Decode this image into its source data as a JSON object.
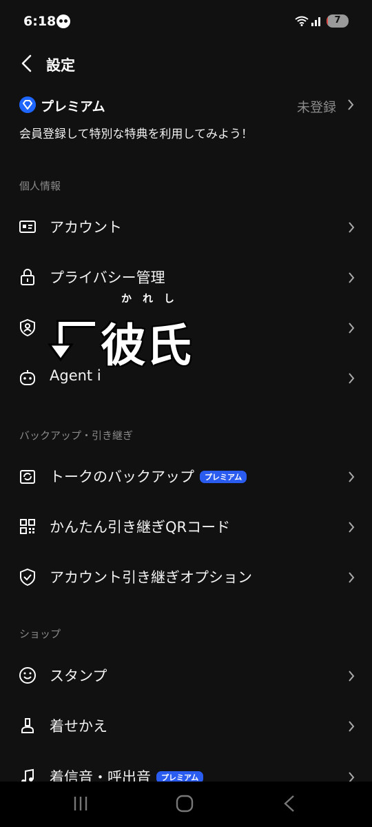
{
  "status_bar": {
    "time": "6:18",
    "battery_level": "7",
    "battery_fraction": 0.07
  },
  "header": {
    "title": "設定"
  },
  "premium": {
    "brand": "プレミアム",
    "status": "未登録",
    "description": "会員登録して特別な特典を利用してみよう！"
  },
  "sections": {
    "personal": {
      "title": "個人情報",
      "items": [
        {
          "label": "アカウント",
          "icon": "id-card-icon"
        },
        {
          "label": "プライバシー管理",
          "icon": "lock-icon"
        },
        {
          "label": "",
          "icon": "shield-user-icon"
        },
        {
          "label": "Agent i",
          "icon": "robot-icon"
        }
      ]
    },
    "backup": {
      "title": "バックアップ・引き継ぎ",
      "items": [
        {
          "label": "トークのバックアップ",
          "icon": "backup-icon",
          "badge": "プレミアム"
        },
        {
          "label": "かんたん引き継ぎQRコード",
          "icon": "qr-code-icon"
        },
        {
          "label": "アカウント引き継ぎオプション",
          "icon": "shield-check-icon"
        }
      ]
    },
    "shop": {
      "title": "ショップ",
      "items": [
        {
          "label": "スタンプ",
          "icon": "smiley-icon"
        },
        {
          "label": "着せかえ",
          "icon": "brush-icon"
        },
        {
          "label": "着信音・呼出音",
          "icon": "music-note-icon",
          "badge": "プレミアム"
        }
      ]
    }
  },
  "overlay": {
    "ruby": "かれし",
    "text": "彼氏"
  },
  "colors": {
    "background": "#111111",
    "accent": "#2a5cf0",
    "muted_text": "#8a8a8a"
  }
}
